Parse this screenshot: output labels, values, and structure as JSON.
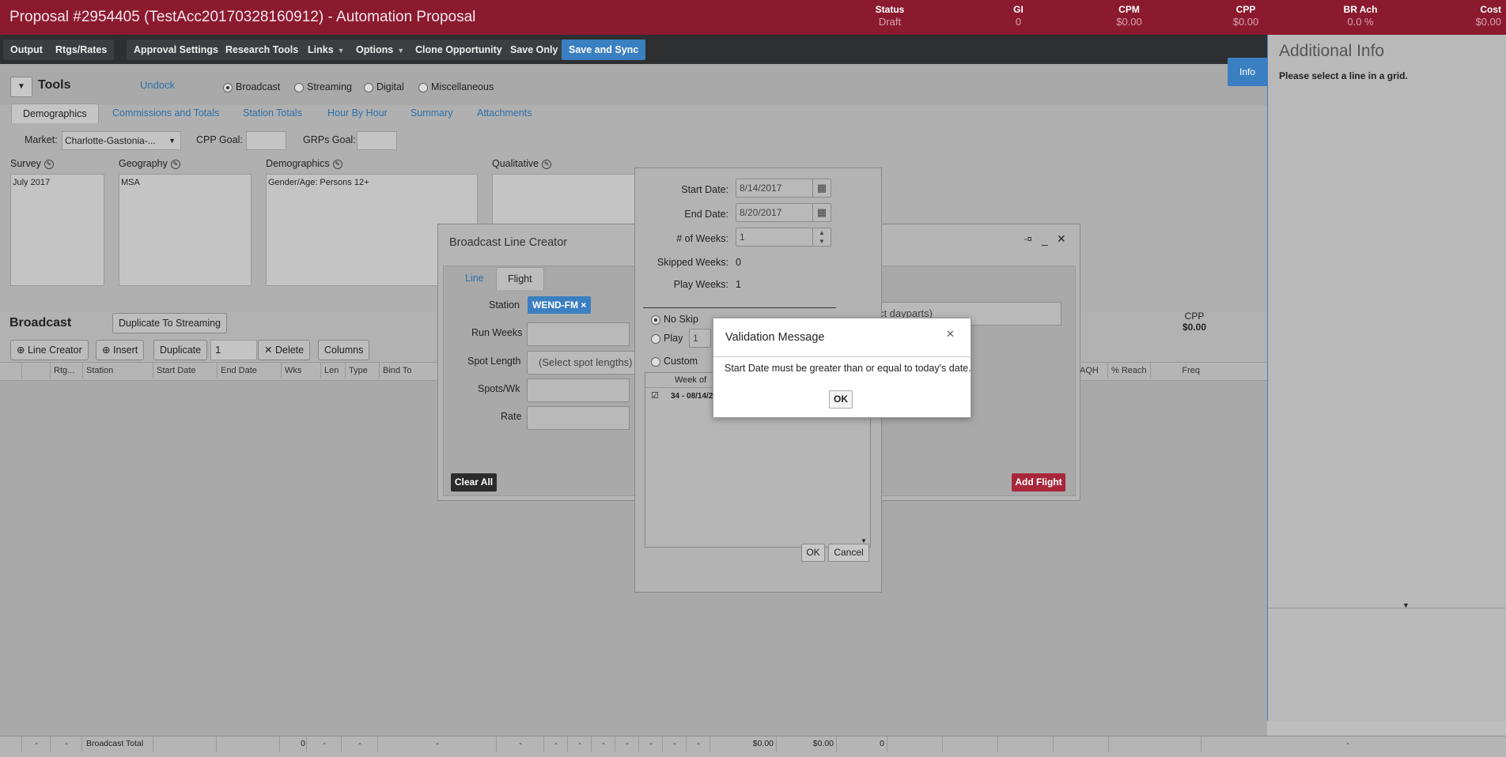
{
  "header": {
    "title": "Proposal #2954405 (TestAcc20170328160912) - Automation Proposal",
    "stats": [
      {
        "label": "Status",
        "value": "Draft"
      },
      {
        "label": "GI",
        "value": "0"
      },
      {
        "label": "CPM",
        "value": "$0.00"
      },
      {
        "label": "CPP",
        "value": "$0.00"
      },
      {
        "label": "BR Ach",
        "value": "0.0 %"
      },
      {
        "label": "Cost",
        "value": "$0.00"
      }
    ]
  },
  "toolbar": {
    "output": "Output",
    "rtgs": "Rtgs/Rates",
    "approval": "Approval Settings",
    "research": "Research Tools",
    "links": "Links",
    "options": "Options",
    "clone": "Clone Opportunity",
    "save_only": "Save Only",
    "save_sync": "Save and Sync"
  },
  "tools": {
    "title": "Tools",
    "undock": "Undock",
    "radios": [
      "Broadcast",
      "Streaming",
      "Digital",
      "Miscellaneous"
    ],
    "selected": "Broadcast",
    "tabs": [
      "Demographics",
      "Commissions and Totals",
      "Station Totals",
      "Hour By Hour",
      "Summary",
      "Attachments"
    ],
    "active_tab": "Demographics",
    "market_label": "Market:",
    "market_value": "Charlotte-Gastonia-...",
    "cpp_goal_label": "CPP Goal:",
    "grps_goal_label": "GRPs Goal:",
    "survey_label": "Survey",
    "survey_value": "July 2017",
    "geography_label": "Geography",
    "geography_value": "MSA",
    "demographics_label": "Demographics",
    "demographics_value": "Gender/Age: Persons 12+",
    "qualitative_label": "Qualitative"
  },
  "broadcast": {
    "title": "Broadcast",
    "dup_streaming": "Duplicate To Streaming",
    "line_creator": "Line Creator",
    "insert": "Insert",
    "duplicate": "Duplicate",
    "dup_count": "1",
    "delete": "Delete",
    "columns": "Columns",
    "cpp_label": "CPP",
    "cpp_value": "$0.00",
    "columns_list": [
      "Rtg...",
      "Station",
      "Start Date",
      "End Date",
      "Wks",
      "Len",
      "Type",
      "Bind To"
    ],
    "right_columns": [
      "AQH",
      "% Reach",
      "Freq"
    ]
  },
  "right_panel": {
    "info_tab": "Info",
    "title": "Additional Info",
    "message": "Please select a line in a grid."
  },
  "line_creator": {
    "title": "Broadcast Line Creator",
    "tabs": [
      "Line",
      "Flight"
    ],
    "active_tab": "Flight",
    "station_label": "Station",
    "station_chip": "WEND-FM",
    "run_weeks_label": "Run Weeks",
    "spot_length_label": "Spot Length",
    "spot_length_placeholder": "(Select spot lengths)",
    "spots_wk_label": "Spots/Wk",
    "rate_label": "Rate",
    "dayparts_placeholder": "ct dayparts)",
    "clear_all": "Clear All",
    "add_flight": "Add Flight"
  },
  "flight_dialog": {
    "start_label": "Start Date:",
    "start_value": "8/14/2017",
    "end_label": "End Date:",
    "end_value": "8/20/2017",
    "weeks_label": "# of Weeks:",
    "weeks_value": "1",
    "skipped_label": "Skipped Weeks:",
    "skipped_value": "0",
    "play_label": "Play Weeks:",
    "play_value": "1",
    "no_skip": "No Skip",
    "play": "Play",
    "play_count": "1",
    "custom": "Custom",
    "week_of": "Week of",
    "week_row": "34 - 08/14/2",
    "ok": "OK",
    "cancel": "Cancel"
  },
  "modal": {
    "title": "Validation Message",
    "message": "Start Date must be greater than or equal to today's date.",
    "ok": "OK"
  },
  "footer": {
    "dash": "-",
    "label": "Broadcast Total",
    "zero": "0",
    "amount1": "$0.00",
    "amount2": "$0.00",
    "zero2": "0"
  }
}
